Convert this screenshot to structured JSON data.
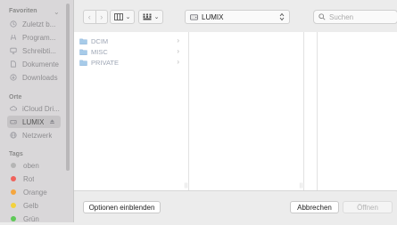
{
  "sidebar": {
    "favorites_title": "Favoriten",
    "favorites": [
      {
        "label": "Zuletzt b...",
        "icon": "clock-icon"
      },
      {
        "label": "Program...",
        "icon": "applications-icon"
      },
      {
        "label": "Schreibti...",
        "icon": "desktop-icon"
      },
      {
        "label": "Dokumente",
        "icon": "document-icon"
      },
      {
        "label": "Downloads",
        "icon": "download-icon"
      }
    ],
    "places_title": "Orte",
    "places": [
      {
        "label": "iCloud Dri...",
        "icon": "cloud-icon"
      },
      {
        "label": "LUMIX",
        "icon": "drive-icon"
      },
      {
        "label": "Netzwerk",
        "icon": "globe-icon"
      }
    ],
    "tags_title": "Tags",
    "tags": [
      {
        "label": "oben",
        "color": "#b5b5b5"
      },
      {
        "label": "Rot",
        "color": "#f0625c"
      },
      {
        "label": "Orange",
        "color": "#f5a63f"
      },
      {
        "label": "Gelb",
        "color": "#f3d23d"
      },
      {
        "label": "Grün",
        "color": "#5fc957"
      }
    ]
  },
  "toolbar": {
    "location_label": "LUMIX",
    "search_placeholder": "Suchen"
  },
  "browser": {
    "items": [
      {
        "label": "DCIM"
      },
      {
        "label": "MISC"
      },
      {
        "label": "PRIVATE"
      }
    ]
  },
  "footer": {
    "options_label": "Optionen einblenden",
    "cancel_label": "Abbrechen",
    "open_label": "Öffnen"
  },
  "colors": {
    "folder": "#9cc3e6",
    "accent": "#3478f6"
  }
}
